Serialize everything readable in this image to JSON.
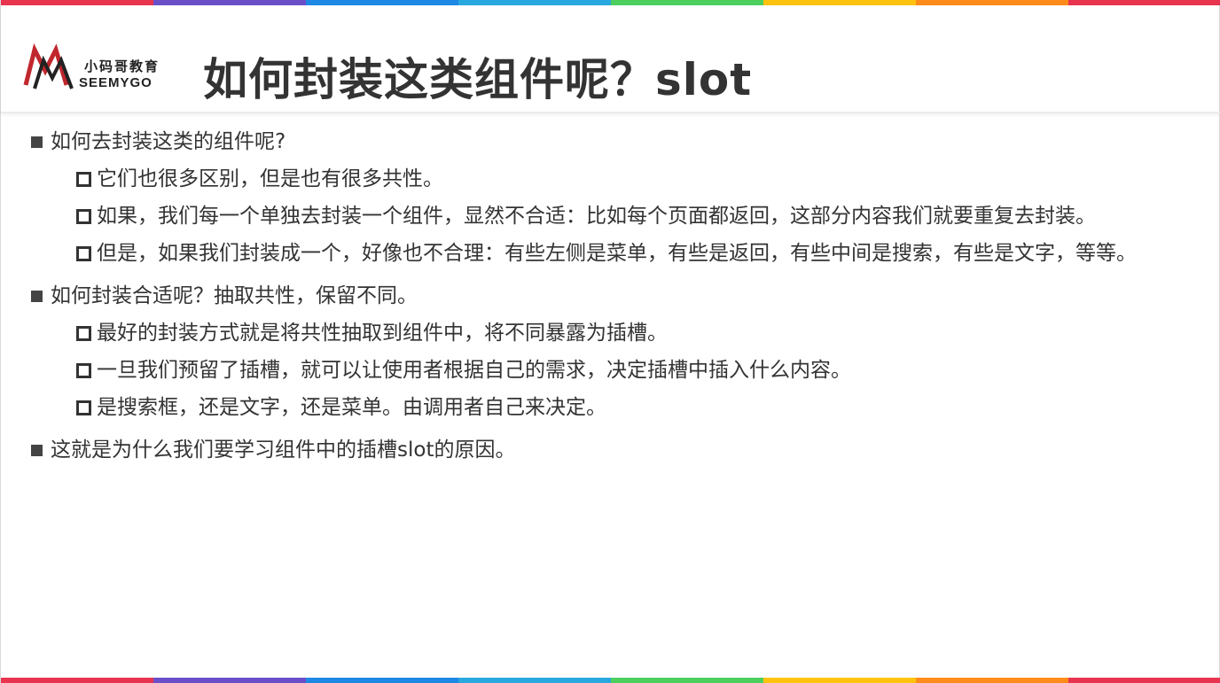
{
  "colors": {
    "stripe": [
      "#e8344e",
      "#6a4fc8",
      "#1e88e5",
      "#29a8df",
      "#4ccf5e",
      "#ffc20e",
      "#ff8c1a",
      "#e8344e"
    ],
    "logo_red": "#c0272d",
    "logo_dark": "#222222"
  },
  "logo": {
    "cn": "小码哥教育",
    "en": "SEEMYGO"
  },
  "title": "如何封装这类组件呢？slot",
  "bullets": [
    {
      "text": "如何去封装这类的组件呢?",
      "children": [
        "它们也很多区别，但是也有很多共性。",
        "如果，我们每一个单独去封装一个组件，显然不合适：比如每个页面都返回，这部分内容我们就要重复去封装。",
        "但是，如果我们封装成一个，好像也不合理：有些左侧是菜单，有些是返回，有些中间是搜索，有些是文字，等等。"
      ]
    },
    {
      "text": "如何封装合适呢？抽取共性，保留不同。",
      "children": [
        "最好的封装方式就是将共性抽取到组件中，将不同暴露为插槽。",
        "一旦我们预留了插槽，就可以让使用者根据自己的需求，决定插槽中插入什么内容。",
        "是搜索框，还是文字，还是菜单。由调用者自己来决定。"
      ]
    },
    {
      "text": "这就是为什么我们要学习组件中的插槽slot的原因。",
      "children": []
    }
  ]
}
